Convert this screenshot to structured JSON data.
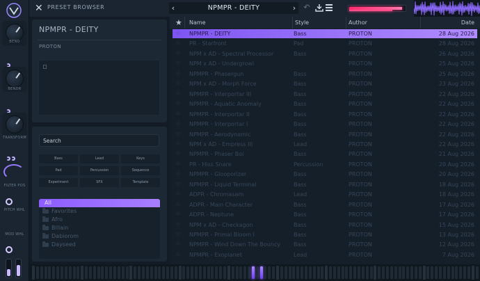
{
  "header": {
    "close_icon": "close-x-icon",
    "title": "PRESET BROWSER",
    "current_preset": "NPMPR - DEITY",
    "prev_icon": "chevron-left-icon",
    "next_icon": "chevron-right-icon",
    "undo_icon": "undo-icon",
    "save_icon": "download-icon",
    "menu_icon": "hamburger-menu-icon",
    "level_meter": {
      "left": 0.95,
      "right": 0.78
    },
    "accent_color": "#8e5dff",
    "meter_color": "#ff2a6d"
  },
  "macros": [
    {
      "label": "BEND"
    },
    {
      "label": "BENDR"
    },
    {
      "label": "TRANSFORM"
    },
    {
      "label": "FILTER POS"
    },
    {
      "label": "PITCH WHL"
    },
    {
      "label": "MOD WHL"
    }
  ],
  "info_panel": {
    "preset_name": "NPMPR - DEITY",
    "author": "PROTON",
    "description": ""
  },
  "filter_panel": {
    "search_placeholder": "Search",
    "tags": [
      "Bass",
      "Lead",
      "Keys",
      "Pad",
      "Percussion",
      "Sequence",
      "Experiment",
      "SFX",
      "Template"
    ],
    "banks": [
      {
        "label": "All",
        "selected": true
      },
      {
        "label": "Favorites",
        "selected": false
      },
      {
        "label": "Afro",
        "selected": false
      },
      {
        "label": "Billain",
        "selected": false
      },
      {
        "label": "Dabiorom",
        "selected": false
      },
      {
        "label": "Dayseed",
        "selected": false
      }
    ]
  },
  "table": {
    "columns": {
      "name": "Name",
      "style": "Style",
      "author": "Author",
      "date": "Date"
    },
    "rows": [
      {
        "name": "NPMPR - DEITY",
        "style": "Bass",
        "author": "PROTON",
        "date": "28 Aug 2026",
        "selected": true
      },
      {
        "name": "PR - Starfront",
        "style": "Pad",
        "author": "PROTON",
        "date": "28 Aug 2026"
      },
      {
        "name": "NPM x AD - Spectral Processor",
        "style": "Bass",
        "author": "PROTON",
        "date": "26 Aug 2026"
      },
      {
        "name": "NPM x AD - Undergrowl",
        "style": "",
        "author": "PROTON",
        "date": "25 Aug 2026"
      },
      {
        "name": "NPMPR - Phasergun",
        "style": "Bass",
        "author": "PROTON",
        "date": "25 Aug 2026"
      },
      {
        "name": "NPM x AD - Morph Force",
        "style": "Bass",
        "author": "PROTON",
        "date": "23 Aug 2026"
      },
      {
        "name": "NPMPR - Interportar III",
        "style": "Bass",
        "author": "PROTON",
        "date": "22 Aug 2026"
      },
      {
        "name": "NPMPR - Aquatic Anomaly",
        "style": "Bass",
        "author": "PROTON",
        "date": "22 Aug 2026"
      },
      {
        "name": "NPMPR - Interportar II",
        "style": "Bass",
        "author": "PROTON",
        "date": "22 Aug 2026"
      },
      {
        "name": "NPMPR - Interportar I",
        "style": "Bass",
        "author": "PROTON",
        "date": "22 Aug 2026"
      },
      {
        "name": "NPMPR - Aerodynamic",
        "style": "Bass",
        "author": "PROTON",
        "date": "22 Aug 2026"
      },
      {
        "name": "NPM x AD - Empress III",
        "style": "Lead",
        "author": "PROTON",
        "date": "22 Aug 2026"
      },
      {
        "name": "NPMPR - Phaser Boi",
        "style": "Bass",
        "author": "PROTON",
        "date": "21 Aug 2026"
      },
      {
        "name": "PR - Hiss Snare",
        "style": "Percussion",
        "author": "PROTON",
        "date": "20 Aug 2026"
      },
      {
        "name": "NPMPR - Glooporizer",
        "style": "Bass",
        "author": "PROTON",
        "date": "20 Aug 2026"
      },
      {
        "name": "NPMPR - Liquid Terminal",
        "style": "Bass",
        "author": "PROTON",
        "date": "18 Aug 2026"
      },
      {
        "name": "ADPR - Chromasam",
        "style": "Lead",
        "author": "PROTON",
        "date": "18 Aug 2026"
      },
      {
        "name": "ADPR - Main Character",
        "style": "Bass",
        "author": "PROTON",
        "date": "17 Aug 2026"
      },
      {
        "name": "ADPR - Neptune",
        "style": "Bass",
        "author": "PROTON",
        "date": "17 Aug 2026"
      },
      {
        "name": "NPM x AD - Checkagon",
        "style": "Bass",
        "author": "PROTON",
        "date": "15 Aug 2026"
      },
      {
        "name": "NPMPR - Primal Bloom I",
        "style": "Bass",
        "author": "PROTON",
        "date": "13 Aug 2026"
      },
      {
        "name": "NPMPR - Wind Down The Bouncy",
        "style": "Bass",
        "author": "PROTON",
        "date": "12 Aug 2026"
      },
      {
        "name": "NPMPR - Exoplanet",
        "style": "Lead",
        "author": "PROTON",
        "date": "7 Aug 2026"
      }
    ]
  },
  "keyboard": {
    "lit_keys": [
      4,
      5,
      6,
      7
    ]
  }
}
